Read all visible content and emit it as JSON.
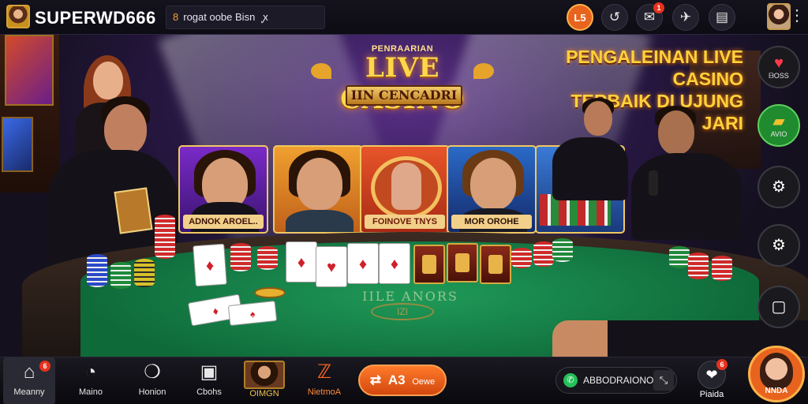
{
  "header": {
    "brand": "SUPERWD666",
    "ticker_icon": "8",
    "ticker_text": "rogat oobe Bisn",
    "ticker_extra": "ꭙ",
    "icons": [
      {
        "name": "level-badge-icon",
        "glyph": "L5"
      },
      {
        "name": "history-icon",
        "glyph": "↺"
      },
      {
        "name": "gift-icon",
        "glyph": "✉",
        "badge": "1"
      },
      {
        "name": "share-icon",
        "glyph": "✈"
      },
      {
        "name": "wallet-icon",
        "glyph": "▤"
      }
    ],
    "menu_glyph": "⋮"
  },
  "promo": {
    "title_small": "PENRAARIAN",
    "title_big": "LIVE CASINO",
    "title_ribbon": "IIN CENCADRI",
    "tagline_line1": "PENGALEINAN LIVE CASINO",
    "tagline_line2": "TERBAIK DI UJUNG JARI"
  },
  "game_cards": [
    {
      "label": "ADNOK AROEL..",
      "bg1": "#7a2ac8",
      "bg2": "#3a1470",
      "labelbg": "#f3d08a",
      "labelcolor": "#3a1208"
    },
    {
      "label": "",
      "bg1": "#f0a030",
      "bg2": "#c0601a",
      "labelbg": "",
      "labelcolor": ""
    },
    {
      "label": "FOINOVE TNYS",
      "bg1": "#e8552a",
      "bg2": "#a82a14",
      "labelbg": "#f3d08a",
      "labelcolor": "#6a1a08"
    },
    {
      "label": "MOR OROHE",
      "bg1": "#2a6ac8",
      "bg2": "#142a6a",
      "labelbg": "#f3d08a",
      "labelcolor": "#2a1208"
    },
    {
      "label": "",
      "bg1": "#3a7ad8",
      "bg2": "#1a3a7a",
      "labelbg": "",
      "labelcolor": ""
    }
  ],
  "table": {
    "felt_text": "IILE ANORS",
    "ring_text": "IZI"
  },
  "right_rail": [
    {
      "glyph": "♥",
      "label": "ᗷOSS",
      "green": false
    },
    {
      "glyph": "▰",
      "label": "AVIO",
      "green": true
    },
    {
      "glyph": "⚙",
      "label": "",
      "green": false
    },
    {
      "glyph": "⚙",
      "label": "",
      "green": false
    },
    {
      "glyph": "▢",
      "label": "",
      "green": false
    }
  ],
  "bottom_nav": [
    {
      "glyph": "⌂",
      "label": "Meanny",
      "type": "active",
      "badge": "6"
    },
    {
      "glyph": "◔",
      "label": "Maino",
      "type": "",
      "badge": ""
    },
    {
      "glyph": "❍",
      "label": "Honion",
      "type": "",
      "badge": ""
    },
    {
      "glyph": "▣",
      "label": "Cbohs",
      "type": "",
      "badge": ""
    },
    {
      "glyph": "",
      "label": "OIMGN",
      "type": "thumb",
      "badge": ""
    },
    {
      "glyph": "ℤ",
      "label": "NietmoA",
      "type": "orange",
      "badge": ""
    }
  ],
  "pill": {
    "icon": "⇄",
    "value": "A3",
    "label": "Oewe"
  },
  "search": {
    "text": "ABBODRAIONOAO",
    "close": "⤡"
  },
  "chat": {
    "label": "Piaida",
    "badge": "6"
  },
  "avatar_label": "NNDA",
  "colors": {
    "accent": "#e8641e",
    "gold": "#ffd23a",
    "felt": "#1f9a58",
    "green_btn": "#1f8a2e"
  }
}
